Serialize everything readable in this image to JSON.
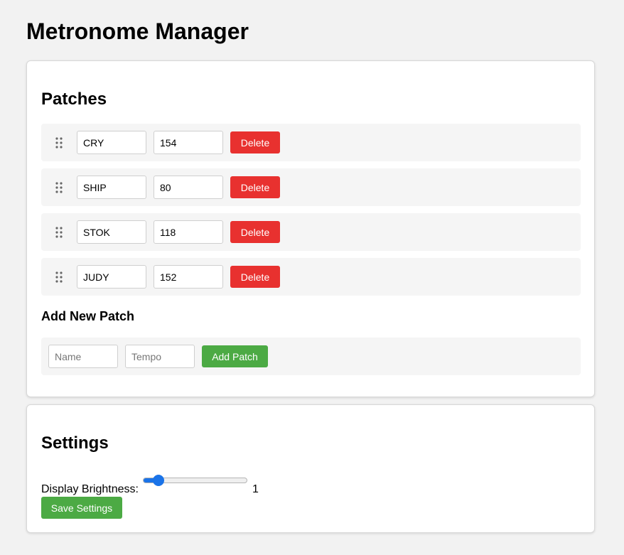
{
  "app": {
    "title": "Metronome Manager"
  },
  "patches_section": {
    "title": "Patches",
    "delete_label": "Delete",
    "patches": [
      {
        "name": "CRY",
        "tempo": "154"
      },
      {
        "name": "SHIP",
        "tempo": "80"
      },
      {
        "name": "STOK",
        "tempo": "118"
      },
      {
        "name": "JUDY",
        "tempo": "152"
      }
    ]
  },
  "add_patch": {
    "title": "Add New Patch",
    "name_placeholder": "Name",
    "tempo_placeholder": "Tempo",
    "name_value": "",
    "tempo_value": "",
    "button_label": "Add Patch"
  },
  "settings": {
    "title": "Settings",
    "brightness_label": "Display Brightness:",
    "brightness_value": "1",
    "brightness_level": 0.15,
    "save_label": "Save Settings"
  },
  "colors": {
    "delete": "#e8312f",
    "add": "#4caa44",
    "accent": "#1a73e8",
    "page_background": "#f2f2f2"
  },
  "icons": {
    "drag_handle": "drag-handle-icon"
  }
}
